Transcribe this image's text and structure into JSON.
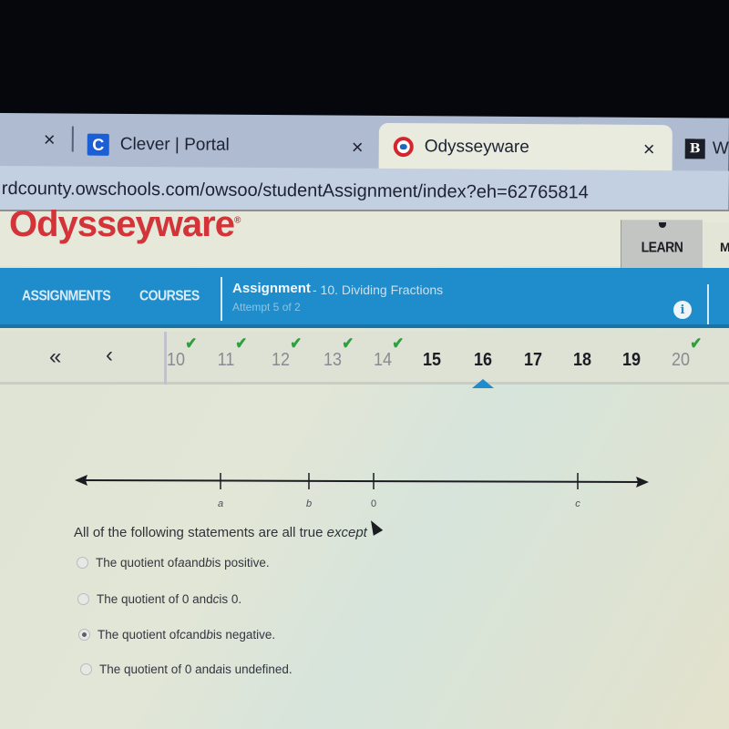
{
  "browser": {
    "tabs": [
      {
        "label": "Clever | Portal",
        "icon": "clever-c-icon",
        "icon_text": "C",
        "active": false
      },
      {
        "label": "Odysseyware",
        "icon": "odysseyware-icon",
        "active": true
      },
      {
        "label": "W",
        "icon": "b-icon",
        "icon_text": "B",
        "active": false
      }
    ],
    "close_glyph": "×",
    "url": "rdcounty.owschools.com/owsoo/studentAssignment/index?eh=62765814"
  },
  "header": {
    "logo": "Odysseyware",
    "logo_mark": "®",
    "learn_label": "LEARN",
    "more_label": "M"
  },
  "navbar": {
    "assignments_label": "ASSIGNMENTS",
    "courses_label": "COURSES",
    "assignment_title": "Assignment",
    "assignment_subtitle": "- 10. Dividing Fractions",
    "attempt": "Attempt 5 of 2",
    "info_glyph": "i"
  },
  "question_nav": {
    "first_glyph": "«",
    "prev_glyph": "‹",
    "check_glyph": "✔",
    "current": 16,
    "questions": [
      {
        "number": "10",
        "completed": true
      },
      {
        "number": "11",
        "completed": true
      },
      {
        "number": "12",
        "completed": true
      },
      {
        "number": "13",
        "completed": true
      },
      {
        "number": "14",
        "completed": true
      },
      {
        "number": "15",
        "completed": false
      },
      {
        "number": "16",
        "completed": false
      },
      {
        "number": "17",
        "completed": false
      },
      {
        "number": "18",
        "completed": false
      },
      {
        "number": "19",
        "completed": false
      },
      {
        "number": "20",
        "completed": true
      }
    ]
  },
  "number_line": {
    "points": [
      {
        "label": "a",
        "italic": true
      },
      {
        "label": "b",
        "italic": true
      },
      {
        "label": "0",
        "italic": false
      },
      {
        "label": "c",
        "italic": true
      }
    ]
  },
  "question": {
    "text": "All of the following statements are all true",
    "emphasis": "except",
    "options": [
      {
        "parts": [
          "The quotient of ",
          "a",
          " and ",
          "b",
          " is positive."
        ],
        "selected": false
      },
      {
        "parts": [
          "The quotient of 0 and ",
          "c",
          " is 0.",
          "",
          ""
        ],
        "selected": false
      },
      {
        "parts": [
          "The quotient of ",
          "c",
          " and ",
          "b",
          " is negative."
        ],
        "selected": true
      },
      {
        "parts": [
          "The quotient of 0 and ",
          "a",
          " is undefined.",
          "",
          ""
        ],
        "selected": false
      }
    ]
  },
  "colors": {
    "brand_red": "#d2343a",
    "nav_blue": "#1f8dcc",
    "check_green": "#2fa03e"
  }
}
